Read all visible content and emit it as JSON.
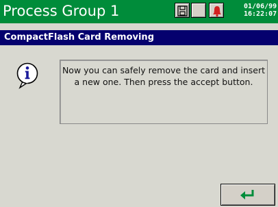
{
  "header": {
    "title": "Process Group 1",
    "date": "01/06/99",
    "time": "16:22:07",
    "color": "#008c3a",
    "buttons": [
      {
        "icon": "save-disk-icon"
      },
      {
        "icon": "blank"
      },
      {
        "icon": "alarm-bell-icon",
        "icon_color": "#d02020"
      }
    ]
  },
  "dialog": {
    "title": "CompactFlash Card Removing",
    "title_bar_color": "#05006e",
    "icon": "info-icon",
    "message": "Now you can safely remove the card and insert a new one. Then press the accept button.",
    "accept_button": {
      "icon": "enter-arrow-icon",
      "icon_color": "#008c3a"
    }
  }
}
